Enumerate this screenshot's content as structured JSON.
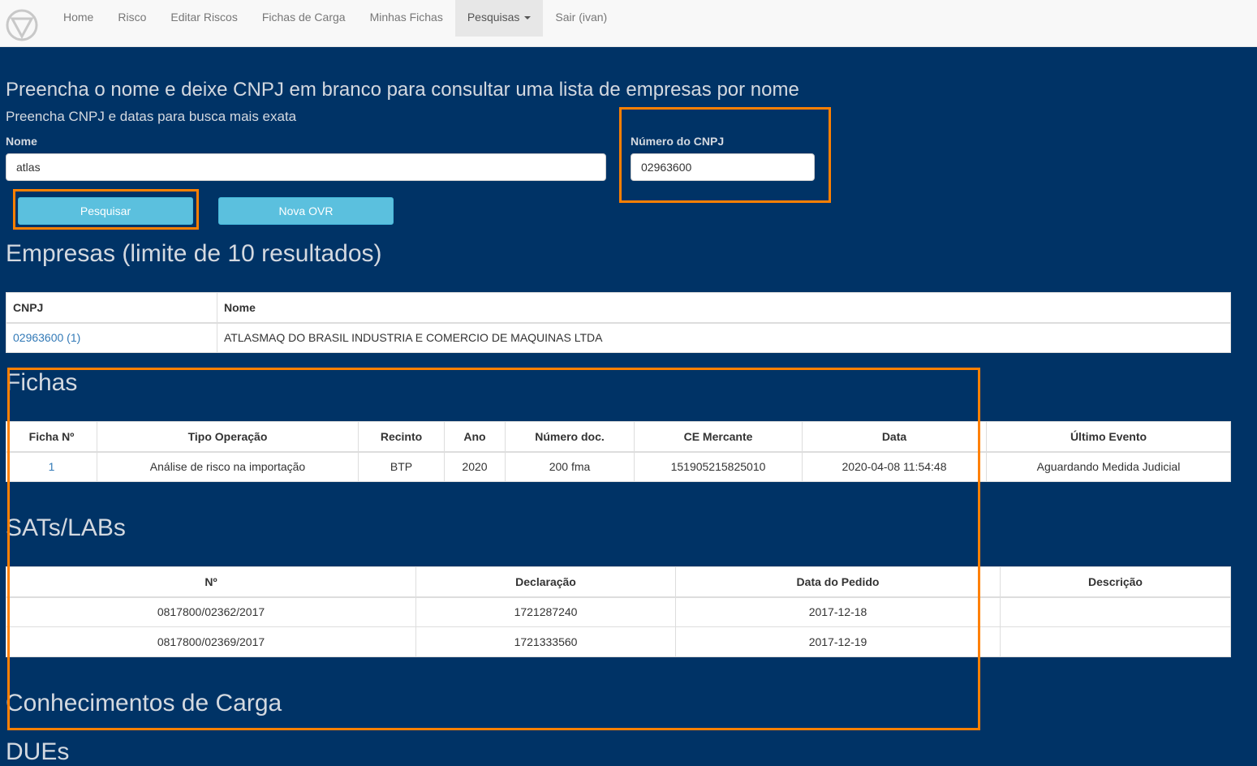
{
  "nav": {
    "items": [
      "Home",
      "Risco",
      "Editar Riscos",
      "Fichas de Carga",
      "Minhas Fichas",
      "Pesquisas",
      "Sair (ivan)"
    ],
    "active_index": 5
  },
  "form": {
    "instruction": "Preencha o nome e deixe CNPJ em branco para consultar uma lista de empresas por nome",
    "subinstruction": "Preencha CNPJ e datas para busca mais exata",
    "nome_label": "Nome",
    "nome_value": "atlas",
    "cnpj_label": "Número do CNPJ",
    "cnpj_value": "02963600",
    "search_button": "Pesquisar",
    "new_ovr_button": "Nova OVR"
  },
  "empresas": {
    "title": "Empresas (limite de 10 resultados)",
    "headers": [
      "CNPJ",
      "Nome"
    ],
    "rows": [
      [
        "02963600 (1)",
        "ATLASMAQ DO BRASIL INDUSTRIA E COMERCIO DE MAQUINAS LTDA"
      ]
    ]
  },
  "fichas": {
    "title": "Fichas",
    "headers": [
      "Ficha Nº",
      "Tipo Operação",
      "Recinto",
      "Ano",
      "Número doc.",
      "CE Mercante",
      "Data",
      "Último Evento"
    ],
    "rows": [
      [
        "1",
        "Análise de risco na importação",
        "BTP",
        "2020",
        "200 fma",
        "151905215825010",
        "2020-04-08 11:54:48",
        "Aguardando Medida Judicial"
      ]
    ]
  },
  "sats": {
    "title": "SATs/LABs",
    "headers": [
      "Nº",
      "Declaração",
      "Data do Pedido",
      "Descrição"
    ],
    "rows": [
      [
        "0817800/02362/2017",
        "1721287240",
        "2017-12-18",
        ""
      ],
      [
        "0817800/02369/2017",
        "1721333560",
        "2017-12-19",
        ""
      ]
    ]
  },
  "conhecimentos": {
    "title": "Conhecimentos de Carga"
  },
  "dues": {
    "title": "DUEs"
  },
  "colors": {
    "page_bg": "#003366",
    "highlight": "#ff8000",
    "button": "#5bc0de",
    "link": "#337ab7"
  }
}
